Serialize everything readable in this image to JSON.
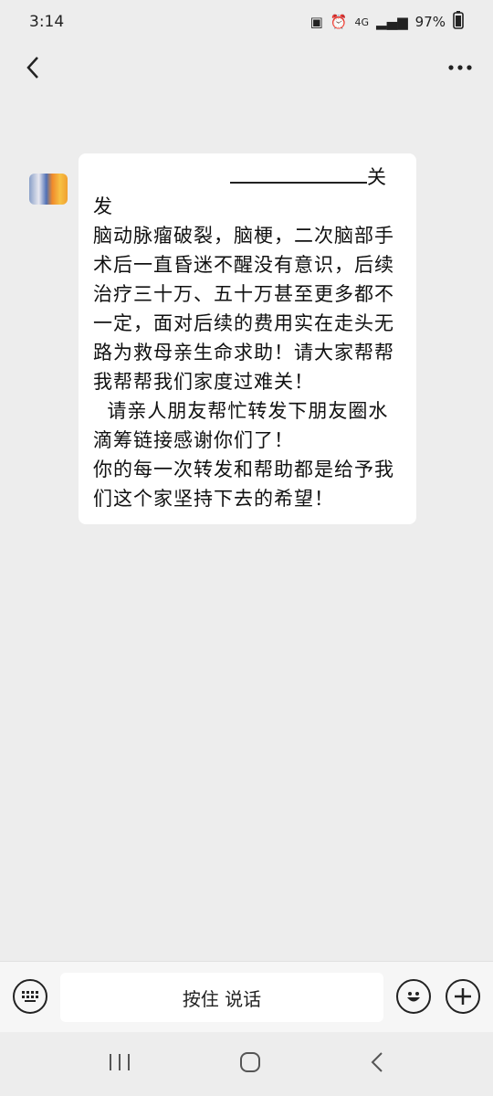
{
  "status_bar": {
    "time": "3:14",
    "network": "4G",
    "battery": "97%"
  },
  "chat": {
    "title": "",
    "message": {
      "line1_suffix": "关发",
      "body": "脑动脉瘤破裂，脑梗，二次脑部手术后一直昏迷不醒没有意识，后续治疗三十万、五十万甚至更多都不一定，面对后续的费用实在走头无路为救母亲生命求助！请大家帮帮我帮帮我们家度过难关！\n  请亲人朋友帮忙转发下朋友圈水滴筹链接感谢你们了！\n你的每一次转发和帮助都是给予我们这个家坚持下去的希望！"
    }
  },
  "input_bar": {
    "hold_to_talk_label": "按住 说话"
  },
  "colors": {
    "background": "#ededed",
    "bubble": "#ffffff",
    "icon": "#222222"
  }
}
